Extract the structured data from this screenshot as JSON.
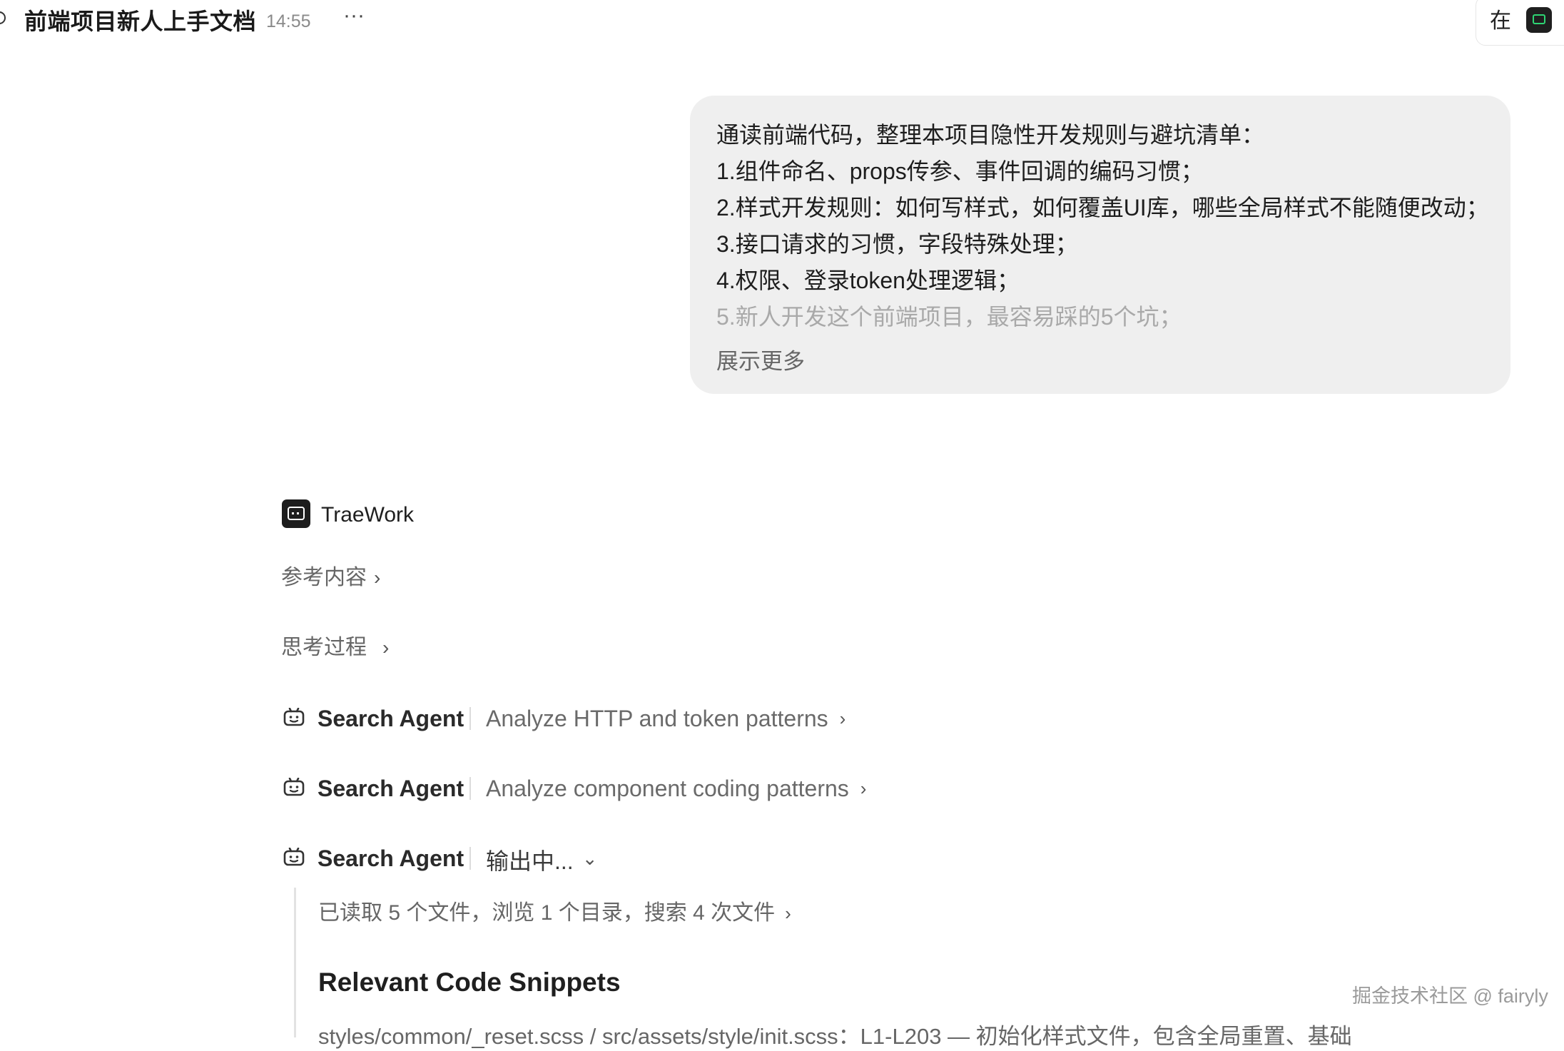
{
  "header": {
    "title": "前端项目新人上手文档",
    "time": "14:55",
    "more_label": "···",
    "status_text": "在"
  },
  "user_message": {
    "lines": [
      "通读前端代码，整理本项目隐性开发规则与避坑清单：",
      "1.组件命名、props传参、事件回调的编码习惯；",
      "2.样式开发规则：如何写样式，如何覆盖UI库，哪些全局样式不能随便改动；",
      "3.接口请求的习惯，字段特殊处理；",
      "4.权限、登录token处理逻辑；",
      "5.新人开发这个前端项目，最容易踩的5个坑；"
    ],
    "show_more": "展示更多"
  },
  "assistant": {
    "name": "TraeWork",
    "references_label": "参考内容",
    "thinking_label": "思考过程",
    "agents": [
      {
        "name": "Search Agent",
        "task": "Analyze HTTP and token patterns",
        "chevron": "›"
      },
      {
        "name": "Search Agent",
        "task": "Analyze component coding patterns",
        "chevron": "›"
      },
      {
        "name": "Search Agent",
        "task": "输出中...",
        "chevron": "⌄"
      }
    ],
    "read_summary": "已读取 5 个文件，浏览 1 个目录，搜索 4 次文件",
    "section_heading": "Relevant Code Snippets",
    "cut_line": "styles/common/_reset.scss / src/assets/style/init.scss：L1-L203 — 初始化样式文件，包含全局重置、基础"
  },
  "watermark": "掘金技术社区 @ fairyly",
  "icons": {
    "header_chat": "chat-bubble-icon",
    "more": "more-horizontal-icon",
    "app": "traework-app-icon",
    "agent": "robot-icon",
    "chevron_right": "chevron-right-icon",
    "chevron_down": "chevron-down-icon"
  },
  "colors": {
    "bubble_bg": "#efefef",
    "text_primary": "#1f1f1f",
    "text_muted": "#666666",
    "app_icon_accent": "#2ed573"
  }
}
